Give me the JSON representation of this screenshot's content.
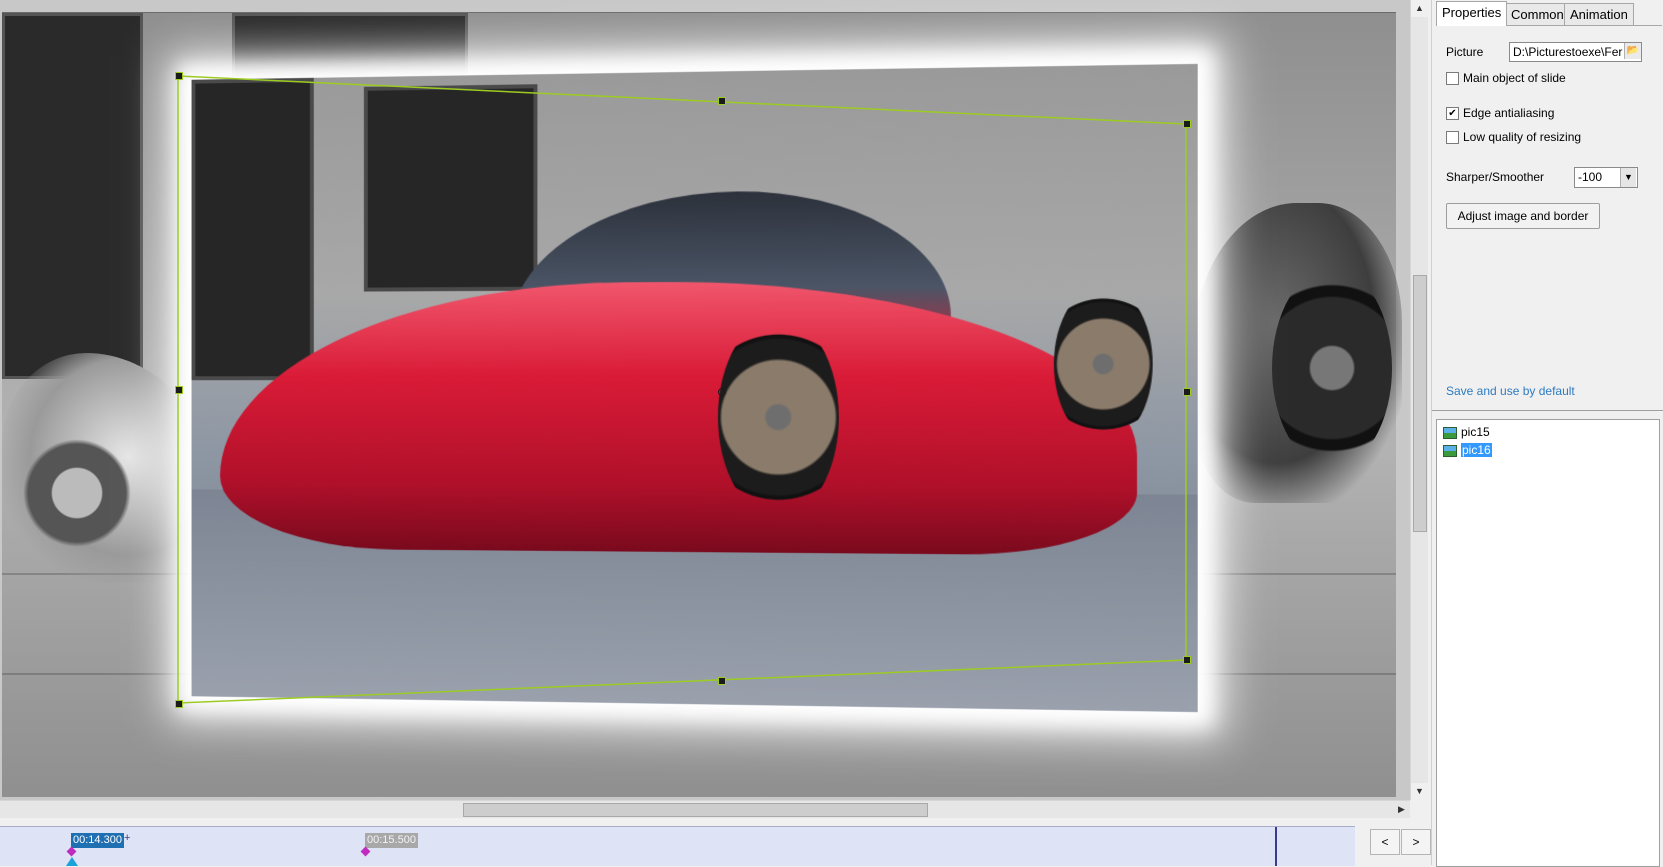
{
  "timeline": {
    "current_time": "00:14.300",
    "next_time": "00:15.500",
    "plus_sign": "+",
    "nav_prev": "<",
    "nav_next": ">"
  },
  "scrollbars": {
    "up_arrow": "▲",
    "down_arrow": "▼",
    "right_arrow": "▶"
  },
  "panel": {
    "tabs": [
      {
        "label": "Properties",
        "active": true
      },
      {
        "label": "Common",
        "active": false
      },
      {
        "label": "Animation",
        "active": false
      }
    ],
    "picture_label": "Picture",
    "picture_path": "D:\\Picturestoexe\\Fer",
    "browse_icon": "folder-open-icon",
    "main_object_label": "Main object of slide",
    "main_object_checked": false,
    "edge_antialiasing_label": "Edge antialiasing",
    "edge_antialiasing_checked": true,
    "low_quality_label": "Low quality of resizing",
    "low_quality_checked": false,
    "sharper_label": "Sharper/Smoother",
    "sharper_value": "-100",
    "adjust_button": "Adjust image and border",
    "save_default": "Save and use by default",
    "check_mark": "✔"
  },
  "slide_list": {
    "items": [
      {
        "label": "pic15",
        "selected": false
      },
      {
        "label": "pic16",
        "selected": true
      }
    ]
  },
  "colors": {
    "selection_frame": "#9ccc21",
    "timeline_bg": "#dfe3f6",
    "current_time_bg": "#1f6fb3",
    "marker": "#c02cbf",
    "list_selected": "#3399ff",
    "link": "#2e7bc0"
  }
}
